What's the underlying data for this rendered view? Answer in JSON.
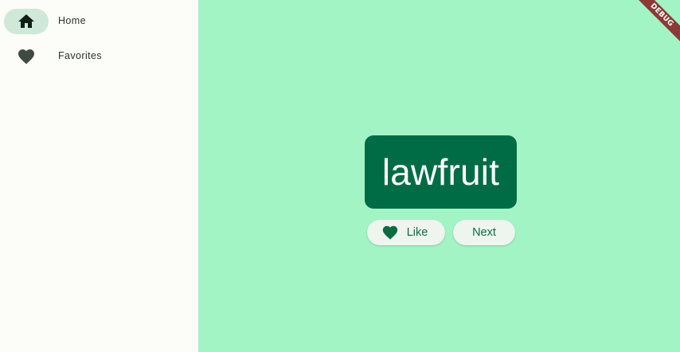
{
  "nav": {
    "items": [
      {
        "label": "Home",
        "icon": "home-icon",
        "selected": true
      },
      {
        "label": "Favorites",
        "icon": "heart-icon",
        "selected": false
      }
    ]
  },
  "main": {
    "word": "lawfruit",
    "like_label": "Like",
    "next_label": "Next"
  },
  "banner": {
    "label": "DEBUG"
  },
  "colors": {
    "rail_background": "#fcfdf8",
    "main_background": "#a3f4c5",
    "card_background": "#006c45",
    "indicator": "#cfe8d8",
    "button_background": "#eef4ee",
    "button_text": "#0d6b44",
    "debug_banner": "#8b3a35"
  }
}
